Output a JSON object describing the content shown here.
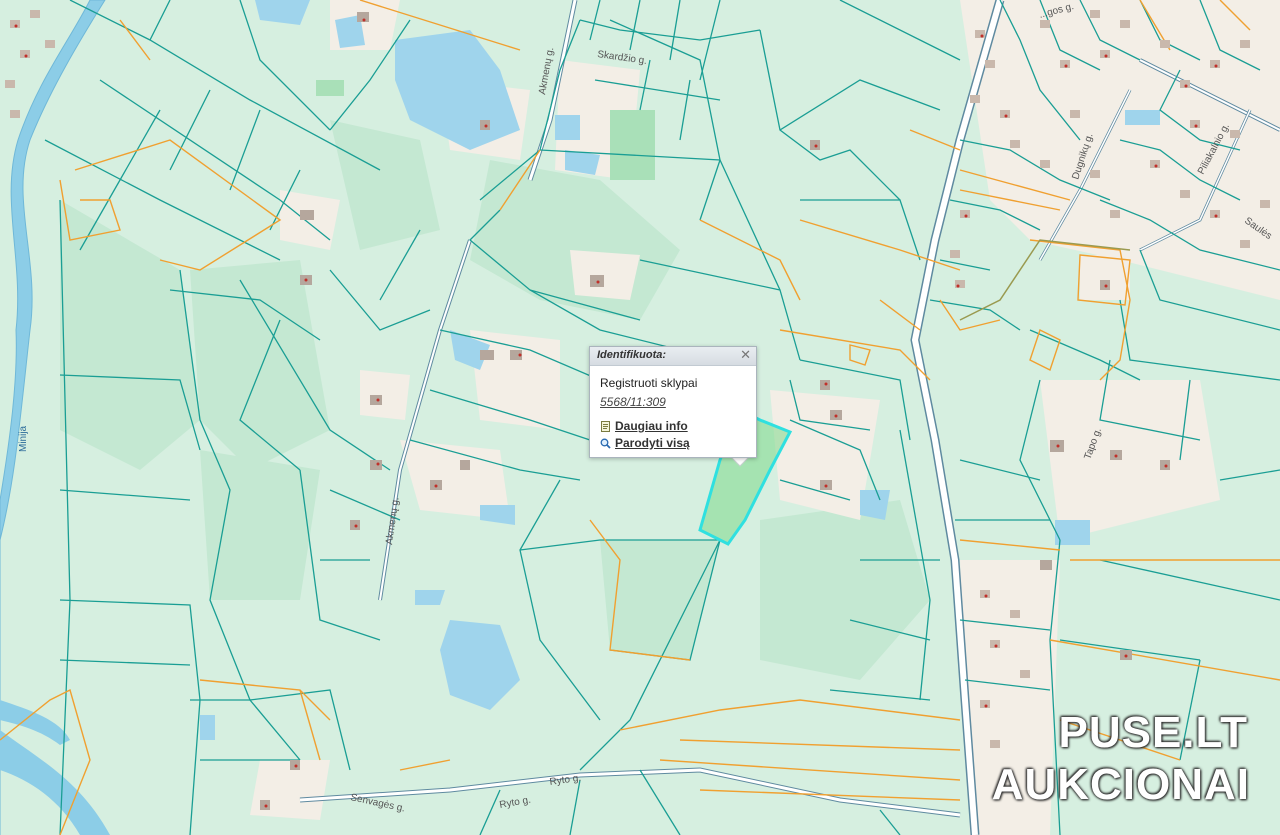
{
  "map": {
    "colors": {
      "background": "#d6efe0",
      "forest": "#c4e8d2",
      "field": "#e6f4ea",
      "water": "#9fd4ec",
      "river": "#7ec3e3",
      "parcel_line": "#1a9e94",
      "zone_line": "#f0a030",
      "road": "#ffffff",
      "road_edge": "#5f8aa0",
      "built": "#f4eee6",
      "house": "#b5a79d",
      "selected_fill": "#7dd88a",
      "selected_line": "#2fe0e0"
    },
    "labels": {
      "river": "Minija",
      "street_akmenu_1": "Akmenų g.",
      "street_akmenu_2": "Akmenų g.",
      "street_skardzio": "Skardžio g.",
      "street_pilialio": "Piliakalnio g.",
      "street_dugno": "Dugnikų g.",
      "street_senvages": "Senvagės g.",
      "street_ryto_1": "Ryto g.",
      "street_ryto_2": "Ryto g.",
      "street_tapo": "Tapo g.",
      "street_top": "...gos g.",
      "street_right": "Saulės"
    }
  },
  "popup": {
    "title": "Identifikuota:",
    "close": "✕",
    "layer": "Registruoti sklypai",
    "parcel": "5568/11:309",
    "more_info": "Daugiau info",
    "show_all": "Parodyti visą"
  },
  "watermark": {
    "line1": "PUSE.LT",
    "line2": "AUKCIONAI"
  }
}
